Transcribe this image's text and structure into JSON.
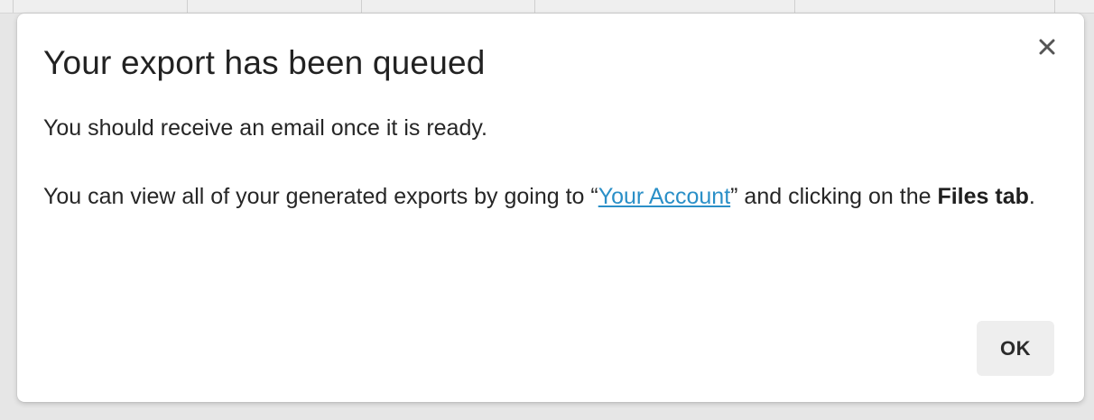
{
  "dialog": {
    "title": "Your export has been queued",
    "message_line1": "You should receive an email once it is ready.",
    "message_part_before_link": "You can view all of your generated exports by going to “",
    "account_link_label": "Your Account",
    "message_part_after_link": "” and clicking on the ",
    "files_tab_label": "Files tab",
    "message_end": ".",
    "ok_label": "OK",
    "close_icon": "close-icon"
  },
  "colors": {
    "link": "#2a8fc7",
    "ok_button_bg": "#eeeeee",
    "text": "#262626"
  }
}
